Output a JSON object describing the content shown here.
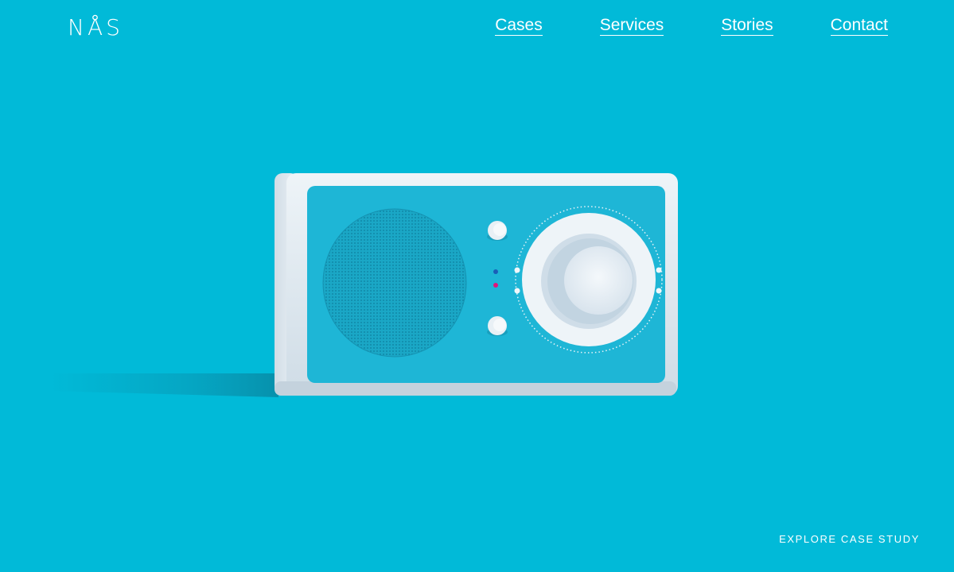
{
  "brand": {
    "logo": "NÅS"
  },
  "nav": {
    "items": [
      {
        "label": "Cases"
      },
      {
        "label": "Services"
      },
      {
        "label": "Stories"
      },
      {
        "label": "Contact"
      }
    ]
  },
  "hero": {
    "image": "radio-product-photo",
    "cta_label": "EXPLORE CASE STUDY"
  },
  "colors": {
    "background": "#01bad8",
    "text": "#ffffff",
    "device_face": "#1eb6d6",
    "device_frame": "#e6eef4",
    "indicator_blue": "#1a5fb8",
    "indicator_pink": "#e0157a"
  }
}
